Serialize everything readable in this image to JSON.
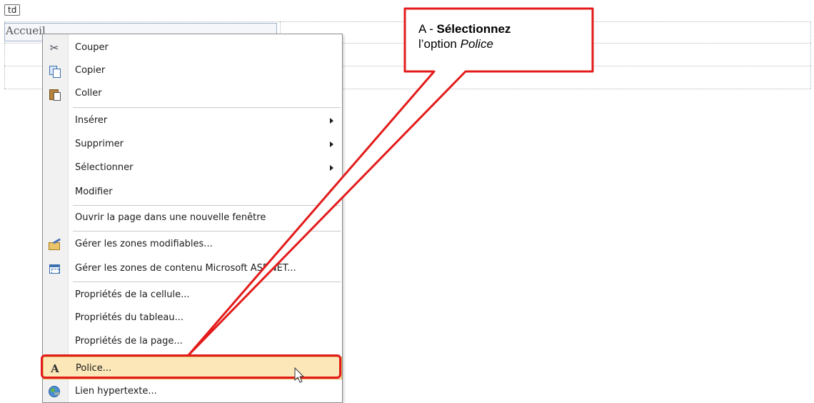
{
  "editor": {
    "tag_label": "td",
    "cell_text": "Accueil"
  },
  "menu": {
    "items": [
      {
        "id": "cut",
        "label": "Couper",
        "icon": "scissors-icon"
      },
      {
        "id": "copy",
        "label": "Copier",
        "icon": "copy-icon"
      },
      {
        "id": "paste",
        "label": "Coller",
        "icon": "paste-icon"
      },
      {
        "id": "insert",
        "label": "Insérer",
        "submenu": true
      },
      {
        "id": "delete",
        "label": "Supprimer",
        "submenu": true
      },
      {
        "id": "select",
        "label": "Sélectionner",
        "submenu": true
      },
      {
        "id": "modify",
        "label": "Modifier",
        "submenu": true
      },
      {
        "id": "open-new-window",
        "label": "Ouvrir la page dans une nouvelle fenêtre"
      },
      {
        "id": "manage-editable-zones",
        "label": "Gérer les zones modifiables...",
        "icon": "editable-zones-icon"
      },
      {
        "id": "manage-content-zones",
        "label": "Gérer les zones de contenu Microsoft ASP.NET...",
        "icon": "content-zone-icon"
      },
      {
        "id": "cell-properties",
        "label": "Propriétés de la cellule..."
      },
      {
        "id": "table-properties",
        "label": "Propriétés du tableau..."
      },
      {
        "id": "page-properties",
        "label": "Propriétés de la page..."
      },
      {
        "id": "font",
        "label": "Police...",
        "icon": "font-icon",
        "highlighted": true
      },
      {
        "id": "hyperlink",
        "label": "Lien hypertexte...",
        "icon": "hyperlink-globe-icon"
      }
    ]
  },
  "callout": {
    "prefix": "A - ",
    "bold": "Sélectionnez",
    "line2_start": "l’option ",
    "italic": "Police"
  },
  "colors": {
    "annotation_red": "#e31b1b",
    "menu_highlight": "#fbe7b8",
    "menu_highlight_border": "#e3b45c"
  }
}
